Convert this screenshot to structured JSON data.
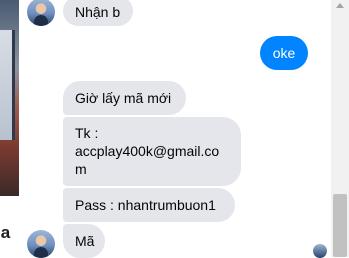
{
  "conversation": {
    "incoming": [
      {
        "text": "Nhận b"
      },
      {
        "text": "Giờ lấy mã mới"
      },
      {
        "text_line1": "Tk :",
        "text_line2": "accplay400k@gmail.co",
        "text_line3": "m"
      },
      {
        "text": "Pass : nhantrumbuon1"
      },
      {
        "text": "Mã"
      }
    ],
    "outgoing": [
      {
        "text": "oke"
      }
    ]
  },
  "side_photo": {
    "caption": "ia"
  },
  "colors": {
    "outgoing_bubble": "#0084ff",
    "incoming_bubble": "#e4e6eb"
  }
}
